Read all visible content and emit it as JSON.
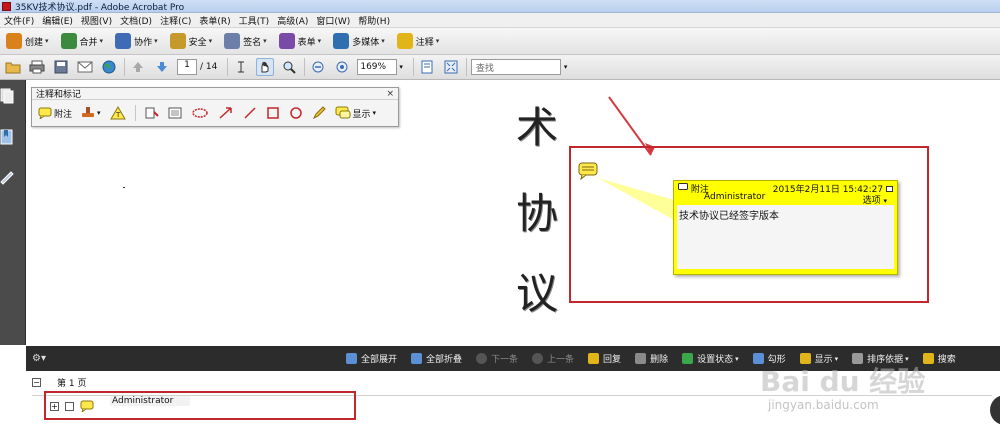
{
  "window": {
    "title": "35KV技术协议.pdf - Adobe Acrobat Pro"
  },
  "menu": [
    "文件(F)",
    "编辑(E)",
    "视图(V)",
    "文档(D)",
    "注释(C)",
    "表单(R)",
    "工具(T)",
    "高级(A)",
    "窗口(W)",
    "帮助(H)"
  ],
  "task_toolbar": [
    {
      "label": "创建",
      "color": "#d9811a"
    },
    {
      "label": "合并",
      "color": "#3b8a3e"
    },
    {
      "label": "协作",
      "color": "#3e6bb3"
    },
    {
      "label": "安全",
      "color": "#c59a2b"
    },
    {
      "label": "签名",
      "color": "#6d7fa8"
    },
    {
      "label": "表单",
      "color": "#7a4aa8"
    },
    {
      "label": "多媒体",
      "color": "#2f6fb0"
    },
    {
      "label": "注释",
      "color": "#e1b51a"
    }
  ],
  "nav": {
    "page_current": "1",
    "page_total": "/ 14",
    "zoom": "169%",
    "search_placeholder": "查找"
  },
  "markup_toolbar": {
    "title": "注释和标记",
    "close": "×",
    "note_label": "附注",
    "show_label": "显示"
  },
  "document_chars": [
    "术",
    "协",
    "议"
  ],
  "popup": {
    "type": "附注",
    "datetime": "2015年2月11日 15:42:27",
    "author": "Administrator",
    "options": "选项",
    "body": "技术协议已经签字版本"
  },
  "comments_panel": {
    "buttons": [
      {
        "label": "全部展开",
        "enabled": true
      },
      {
        "label": "全部折叠",
        "enabled": true
      },
      {
        "label": "下一条",
        "enabled": false
      },
      {
        "label": "上一条",
        "enabled": false
      },
      {
        "label": "回复",
        "enabled": true
      },
      {
        "label": "删除",
        "enabled": true
      },
      {
        "label": "设置状态",
        "enabled": true
      },
      {
        "label": "勾形",
        "enabled": true
      },
      {
        "label": "显示",
        "enabled": true
      },
      {
        "label": "排序依据",
        "enabled": true
      },
      {
        "label": "搜索",
        "enabled": true
      }
    ],
    "page_label": "第 1 页",
    "comment_author": "Administrator"
  },
  "watermark": {
    "text": "Bai du 经验",
    "sub": "jingyan.baidu.com"
  },
  "colors": {
    "accent_red": "#c1272d",
    "popup_yellow": "#ffff00",
    "panel_dark": "#2c2c2c"
  }
}
